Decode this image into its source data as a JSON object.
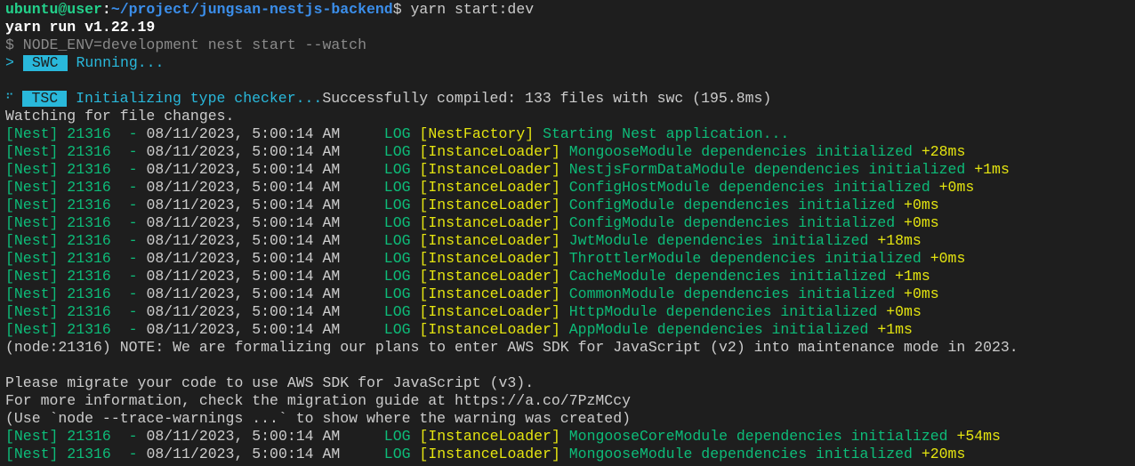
{
  "prompt": {
    "user_host": "ubuntu@user",
    "colon": ":",
    "path": "~/project/jungsan-nestjs-backend",
    "dollar": "$",
    "command": " yarn start:dev"
  },
  "yarn_line": "yarn run v1.22.19",
  "node_env_line": "$ NODE_ENV=development nest start --watch",
  "swc_line": {
    "arrow": ">",
    "badge": "SWC",
    "text": "Running..."
  },
  "blank_1": "",
  "tsc_line": {
    "spinner": "⠋",
    "badge": "TSC",
    "initializing": "Initializing type checker...",
    "compiled": "Successfully compiled: 133 files with swc (195.8ms)"
  },
  "watching_line": "Watching for file changes.",
  "log_lines": [
    {
      "prefix": "[Nest] 21316  - ",
      "timestamp": "08/11/2023, 5:00:14 AM",
      "level": "LOG",
      "context": "[NestFactory]",
      "message": "Starting Nest application...",
      "duration": ""
    },
    {
      "prefix": "[Nest] 21316  - ",
      "timestamp": "08/11/2023, 5:00:14 AM",
      "level": "LOG",
      "context": "[InstanceLoader]",
      "message": "MongooseModule dependencies initialized",
      "duration": "+28ms"
    },
    {
      "prefix": "[Nest] 21316  - ",
      "timestamp": "08/11/2023, 5:00:14 AM",
      "level": "LOG",
      "context": "[InstanceLoader]",
      "message": "NestjsFormDataModule dependencies initialized",
      "duration": "+1ms"
    },
    {
      "prefix": "[Nest] 21316  - ",
      "timestamp": "08/11/2023, 5:00:14 AM",
      "level": "LOG",
      "context": "[InstanceLoader]",
      "message": "ConfigHostModule dependencies initialized",
      "duration": "+0ms"
    },
    {
      "prefix": "[Nest] 21316  - ",
      "timestamp": "08/11/2023, 5:00:14 AM",
      "level": "LOG",
      "context": "[InstanceLoader]",
      "message": "ConfigModule dependencies initialized",
      "duration": "+0ms"
    },
    {
      "prefix": "[Nest] 21316  - ",
      "timestamp": "08/11/2023, 5:00:14 AM",
      "level": "LOG",
      "context": "[InstanceLoader]",
      "message": "ConfigModule dependencies initialized",
      "duration": "+0ms"
    },
    {
      "prefix": "[Nest] 21316  - ",
      "timestamp": "08/11/2023, 5:00:14 AM",
      "level": "LOG",
      "context": "[InstanceLoader]",
      "message": "JwtModule dependencies initialized",
      "duration": "+18ms"
    },
    {
      "prefix": "[Nest] 21316  - ",
      "timestamp": "08/11/2023, 5:00:14 AM",
      "level": "LOG",
      "context": "[InstanceLoader]",
      "message": "ThrottlerModule dependencies initialized",
      "duration": "+0ms"
    },
    {
      "prefix": "[Nest] 21316  - ",
      "timestamp": "08/11/2023, 5:00:14 AM",
      "level": "LOG",
      "context": "[InstanceLoader]",
      "message": "CacheModule dependencies initialized",
      "duration": "+1ms"
    },
    {
      "prefix": "[Nest] 21316  - ",
      "timestamp": "08/11/2023, 5:00:14 AM",
      "level": "LOG",
      "context": "[InstanceLoader]",
      "message": "CommonModule dependencies initialized",
      "duration": "+0ms"
    },
    {
      "prefix": "[Nest] 21316  - ",
      "timestamp": "08/11/2023, 5:00:14 AM",
      "level": "LOG",
      "context": "[InstanceLoader]",
      "message": "HttpModule dependencies initialized",
      "duration": "+0ms"
    },
    {
      "prefix": "[Nest] 21316  - ",
      "timestamp": "08/11/2023, 5:00:14 AM",
      "level": "LOG",
      "context": "[InstanceLoader]",
      "message": "AppModule dependencies initialized",
      "duration": "+1ms"
    }
  ],
  "warning_lines": [
    "(node:21316) NOTE: We are formalizing our plans to enter AWS SDK for JavaScript (v2) into maintenance mode in 2023.",
    "",
    "Please migrate your code to use AWS SDK for JavaScript (v3).",
    "For more information, check the migration guide at https://a.co/7PzMCcy",
    "(Use `node --trace-warnings ...` to show where the warning was created)"
  ],
  "log_lines_2": [
    {
      "prefix": "[Nest] 21316  - ",
      "timestamp": "08/11/2023, 5:00:14 AM",
      "level": "LOG",
      "context": "[InstanceLoader]",
      "message": "MongooseCoreModule dependencies initialized",
      "duration": "+54ms"
    },
    {
      "prefix": "[Nest] 21316  - ",
      "timestamp": "08/11/2023, 5:00:14 AM",
      "level": "LOG",
      "context": "[InstanceLoader]",
      "message": "MongooseModule dependencies initialized",
      "duration": "+20ms"
    }
  ],
  "colors": {
    "background": "#1e1e1e",
    "green": "#0dbc79",
    "bright_green": "#23d18b",
    "yellow": "#e5e510",
    "cyan": "#29b8db",
    "blue": "#3b8eea",
    "foreground": "#cccccc"
  }
}
